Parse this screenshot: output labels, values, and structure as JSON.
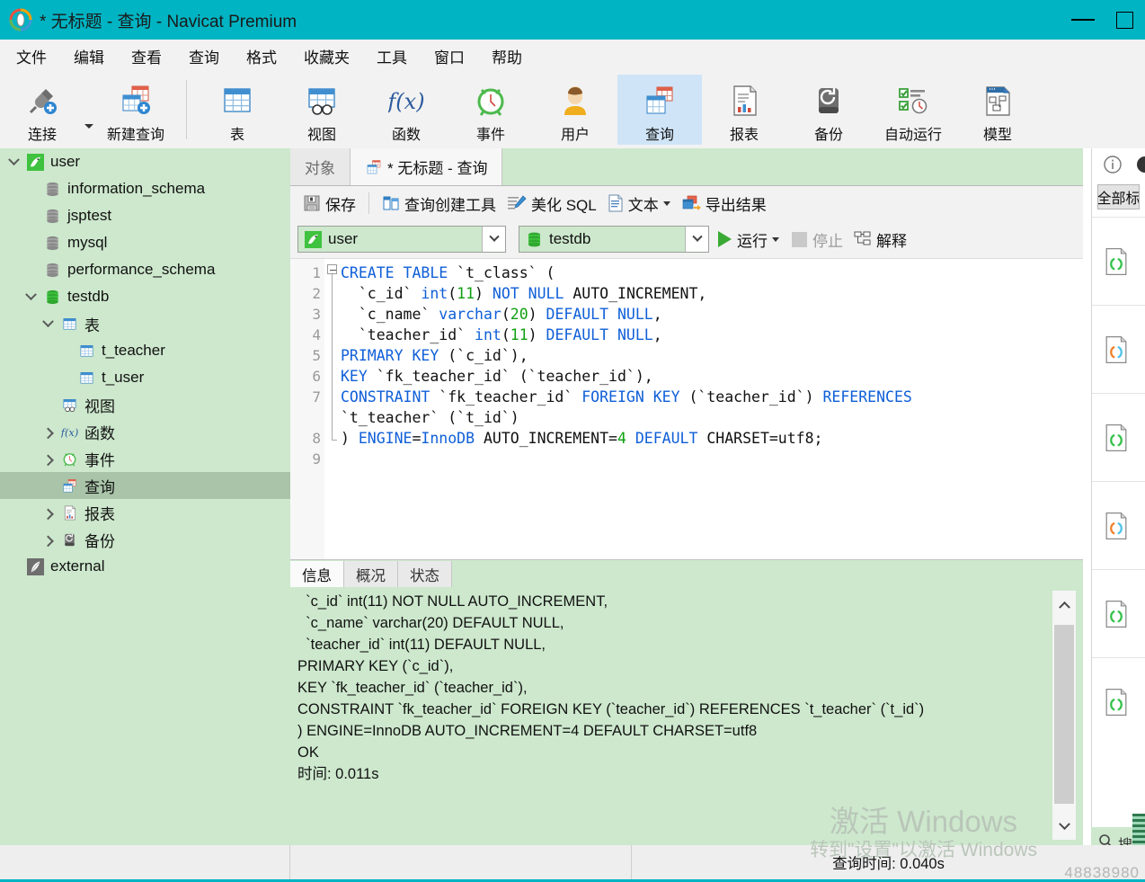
{
  "window": {
    "title": "* 无标题 - 查询 - Navicat Premium",
    "minimize_label": "minimize",
    "maximize_label": "maximize",
    "titlebar_color": "#00b4c3"
  },
  "menubar": {
    "items": [
      "文件",
      "编辑",
      "查看",
      "查询",
      "格式",
      "收藏夹",
      "工具",
      "窗口",
      "帮助"
    ]
  },
  "toolbar": {
    "items": [
      {
        "label": "连接",
        "icon": "plug-plus-icon",
        "selected": false
      },
      {
        "label": "新建查询",
        "icon": "new-query-icon",
        "selected": false
      },
      {
        "label": "表",
        "icon": "table-icon",
        "selected": false
      },
      {
        "label": "视图",
        "icon": "view-icon",
        "selected": false
      },
      {
        "label": "函数",
        "icon": "function-fx-icon",
        "selected": false
      },
      {
        "label": "事件",
        "icon": "event-clock-icon",
        "selected": false
      },
      {
        "label": "用户",
        "icon": "user-icon",
        "selected": false
      },
      {
        "label": "查询",
        "icon": "query-icon",
        "selected": true
      },
      {
        "label": "报表",
        "icon": "report-icon",
        "selected": false
      },
      {
        "label": "备份",
        "icon": "backup-icon",
        "selected": false
      },
      {
        "label": "自动运行",
        "icon": "automation-icon",
        "selected": false
      },
      {
        "label": "模型",
        "icon": "model-icon",
        "selected": false
      }
    ]
  },
  "sidebar": {
    "nodes": [
      {
        "label": "user",
        "icon": "navicat-connection-icon",
        "indent": 0,
        "twisty": "down",
        "selected": false
      },
      {
        "label": "information_schema",
        "icon": "database-gray-icon",
        "indent": 1,
        "twisty": "none",
        "selected": false
      },
      {
        "label": "jsptest",
        "icon": "database-gray-icon",
        "indent": 1,
        "twisty": "none",
        "selected": false
      },
      {
        "label": "mysql",
        "icon": "database-gray-icon",
        "indent": 1,
        "twisty": "none",
        "selected": false
      },
      {
        "label": "performance_schema",
        "icon": "database-gray-icon",
        "indent": 1,
        "twisty": "none",
        "selected": false
      },
      {
        "label": "testdb",
        "icon": "database-green-icon",
        "indent": 1,
        "twisty": "down",
        "selected": false
      },
      {
        "label": "表",
        "icon": "table-icon",
        "indent": 2,
        "twisty": "down",
        "selected": false
      },
      {
        "label": "t_teacher",
        "icon": "table-icon",
        "indent": 3,
        "twisty": "none",
        "selected": false
      },
      {
        "label": "t_user",
        "icon": "table-icon",
        "indent": 3,
        "twisty": "none",
        "selected": false
      },
      {
        "label": "视图",
        "icon": "view-icon",
        "indent": 2,
        "twisty": "none",
        "selected": false
      },
      {
        "label": "函数",
        "icon": "function-fx-icon",
        "indent": 2,
        "twisty": "right",
        "selected": false
      },
      {
        "label": "事件",
        "icon": "event-clock-icon",
        "indent": 2,
        "twisty": "right",
        "selected": false
      },
      {
        "label": "查询",
        "icon": "query-icon",
        "indent": 2,
        "twisty": "none",
        "selected": true
      },
      {
        "label": "报表",
        "icon": "report-icon",
        "indent": 2,
        "twisty": "right",
        "selected": false
      },
      {
        "label": "备份",
        "icon": "backup-icon",
        "indent": 2,
        "twisty": "right",
        "selected": false
      },
      {
        "label": "external",
        "icon": "external-feather-icon",
        "indent": 0,
        "twisty": "none",
        "selected": false
      }
    ]
  },
  "tabs": [
    {
      "label": "对象",
      "icon": "none",
      "active": false
    },
    {
      "label": "* 无标题 - 查询",
      "icon": "query-icon",
      "active": true
    }
  ],
  "query_toolbar": {
    "save": "保存",
    "query_builder": "查询创建工具",
    "beautify_sql": "美化 SQL",
    "text": "文本",
    "export_result": "导出结果"
  },
  "connection_bar": {
    "connection": "user",
    "database": "testdb",
    "run": "运行",
    "stop": "停止",
    "stop_disabled": true,
    "explain": "解释"
  },
  "editor": {
    "line_numbers": [
      "1",
      "2",
      "3",
      "4",
      "5",
      "6",
      "7",
      "",
      "8",
      "9"
    ],
    "lines": [
      "CREATE TABLE `t_class` (",
      "  `c_id` int(11) NOT NULL AUTO_INCREMENT,",
      "  `c_name` varchar(20) DEFAULT NULL,",
      "  `teacher_id` int(11) DEFAULT NULL,",
      "PRIMARY KEY (`c_id`),",
      "KEY `fk_teacher_id` (`teacher_id`),",
      "CONSTRAINT `fk_teacher_id` FOREIGN KEY (`teacher_id`) REFERENCES",
      "`t_teacher` (`t_id`)",
      ") ENGINE=InnoDB AUTO_INCREMENT=4 DEFAULT CHARSET=utf8;",
      ""
    ]
  },
  "results": {
    "tabs": [
      {
        "label": "信息",
        "active": true
      },
      {
        "label": "概况",
        "active": false
      },
      {
        "label": "状态",
        "active": false
      }
    ],
    "output": "  `c_id` int(11) NOT NULL AUTO_INCREMENT,\n  `c_name` varchar(20) DEFAULT NULL,\n  `teacher_id` int(11) DEFAULT NULL,\nPRIMARY KEY (`c_id`),\nKEY `fk_teacher_id` (`teacher_id`),\nCONSTRAINT `fk_teacher_id` FOREIGN KEY (`teacher_id`) REFERENCES `t_teacher` (`t_id`)\n) ENGINE=InnoDB AUTO_INCREMENT=4 DEFAULT CHARSET=utf8\nOK\n时间: 0.011s"
  },
  "right_panel": {
    "select_all_label": "全部标",
    "info_icon": "info-icon",
    "items": [
      {
        "icon": "code-file-green-icon"
      },
      {
        "icon": "code-file-color-icon"
      },
      {
        "icon": "code-file-green-icon"
      },
      {
        "icon": "code-file-color-icon"
      },
      {
        "icon": "code-file-green-icon"
      },
      {
        "icon": "code-file-green-icon"
      }
    ]
  },
  "search": {
    "label": "搜索",
    "icon": "search-icon"
  },
  "statusbar": {
    "query_time": "查询时间: 0.040s"
  },
  "watermark": {
    "line1": "激活 Windows",
    "line2": "转到\"设置\"以激活 Windows",
    "blog_id": "48838980"
  }
}
